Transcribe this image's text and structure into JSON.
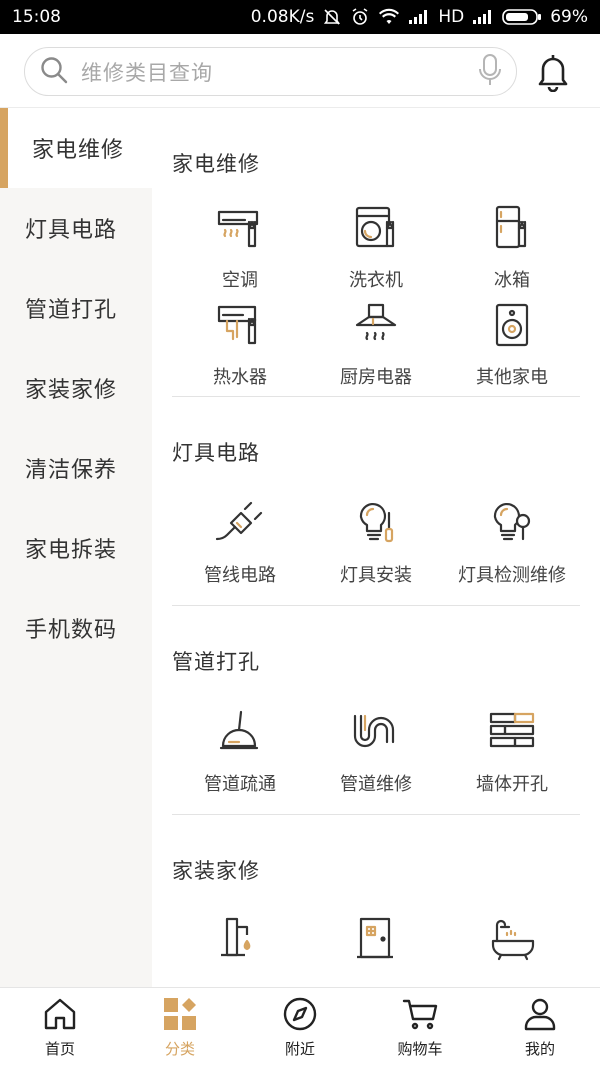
{
  "status": {
    "time": "15:08",
    "speed": "0.08K/s",
    "network": "HD",
    "battery": "69%"
  },
  "search": {
    "placeholder": "维修类目查询"
  },
  "colors": {
    "accent": "#d6a461",
    "sidebar_bg": "#f7f6f4"
  },
  "sidebar": {
    "items": [
      {
        "label": "家电维修",
        "active": true
      },
      {
        "label": "灯具电路"
      },
      {
        "label": "管道打孔"
      },
      {
        "label": "家装家修"
      },
      {
        "label": "清洁保养"
      },
      {
        "label": "家电拆装"
      },
      {
        "label": "手机数码"
      }
    ]
  },
  "sections": [
    {
      "title": "家电维修",
      "items": [
        {
          "label": "空调",
          "icon": "air-conditioner-wrench-icon"
        },
        {
          "label": "洗衣机",
          "icon": "washing-machine-wrench-icon"
        },
        {
          "label": "冰箱",
          "icon": "fridge-wrench-icon"
        },
        {
          "label": "热水器",
          "icon": "water-heater-wrench-icon"
        },
        {
          "label": "厨房电器",
          "icon": "range-hood-icon"
        },
        {
          "label": "其他家电",
          "icon": "speaker-icon"
        }
      ]
    },
    {
      "title": "灯具电路",
      "items": [
        {
          "label": "管线电路",
          "icon": "plug-icon"
        },
        {
          "label": "灯具安装",
          "icon": "bulb-screwdriver-icon"
        },
        {
          "label": "灯具检测维修",
          "icon": "bulb-magnifier-icon"
        }
      ]
    },
    {
      "title": "管道打孔",
      "items": [
        {
          "label": "管道疏通",
          "icon": "plunger-icon"
        },
        {
          "label": "管道维修",
          "icon": "pipe-icon"
        },
        {
          "label": "墙体开孔",
          "icon": "brick-wall-icon"
        }
      ]
    },
    {
      "title": "家装家修",
      "items": [
        {
          "label": "",
          "icon": "faucet-icon"
        },
        {
          "label": "",
          "icon": "door-icon"
        },
        {
          "label": "",
          "icon": "bathtub-icon"
        }
      ]
    }
  ],
  "bottom_nav": [
    {
      "label": "首页",
      "icon": "home-icon"
    },
    {
      "label": "分类",
      "icon": "category-icon",
      "active": true
    },
    {
      "label": "附近",
      "icon": "compass-icon"
    },
    {
      "label": "购物车",
      "icon": "cart-icon"
    },
    {
      "label": "我的",
      "icon": "user-icon"
    }
  ]
}
